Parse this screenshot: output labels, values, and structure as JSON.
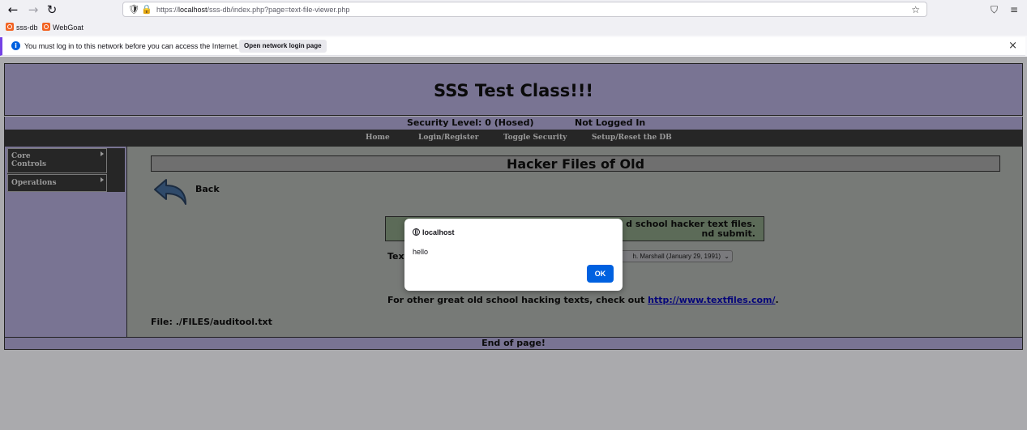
{
  "browser": {
    "url_prefix": "https://",
    "url_host": "localhost",
    "url_path": "/sss-db/index.php?page=text-file-viewer.php",
    "nav": {
      "back": "←",
      "forward": "→",
      "reload": "↻"
    },
    "bookmarks": [
      {
        "label": "sss-db"
      },
      {
        "label": "WebGoat"
      }
    ],
    "icons": {
      "shield": "🛡",
      "lock": "🔒",
      "star": "☆",
      "pocket": "⛉",
      "menu": "≡"
    }
  },
  "notification": {
    "message": "You must log in to this network before you can access the Internet.",
    "button_label": "Open network login page",
    "close": "×",
    "info_glyph": "i"
  },
  "site": {
    "title": "SSS Test Class!!!",
    "security_level": "Security Level: 0 (Hosed)",
    "login_status": "Not Logged In",
    "menu": [
      "Home",
      "Login/Register",
      "Toggle Security",
      "Setup/Reset the DB"
    ],
    "sidebar": [
      "Core Controls",
      "Operations"
    ],
    "footer": "End of page!"
  },
  "panel": {
    "title": "Hacker Files of Old",
    "back_label": "Back",
    "hint_line1": "d school hacker text files.",
    "hint_line2": "nd submit.",
    "field_label": "Text",
    "select_value": "h. Marshall (January 29, 1991)",
    "select_chevron": "⌄",
    "footer_text": "For other great old school hacking texts, check out ",
    "footer_link": "http://www.textfiles.com/",
    "footer_period": ".",
    "file_line": "File: ./FILES/auditool.txt"
  },
  "dialog": {
    "origin": "localhost",
    "message": "hello",
    "ok_label": "OK"
  },
  "colors": {
    "accent": "#0061e0",
    "header_bg": "#797493",
    "menu_bg": "#262626"
  }
}
